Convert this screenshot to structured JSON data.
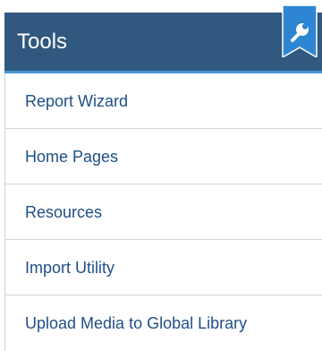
{
  "header": {
    "title": "Tools",
    "icon": "wrench-icon",
    "background_color": "#31597f",
    "accent_color": "#4a96d6"
  },
  "links": [
    {
      "label": "Report Wizard"
    },
    {
      "label": "Home Pages"
    },
    {
      "label": "Resources"
    },
    {
      "label": "Import Utility"
    },
    {
      "label": "Upload Media to Global Library"
    }
  ],
  "link_color": "#1f4f86"
}
